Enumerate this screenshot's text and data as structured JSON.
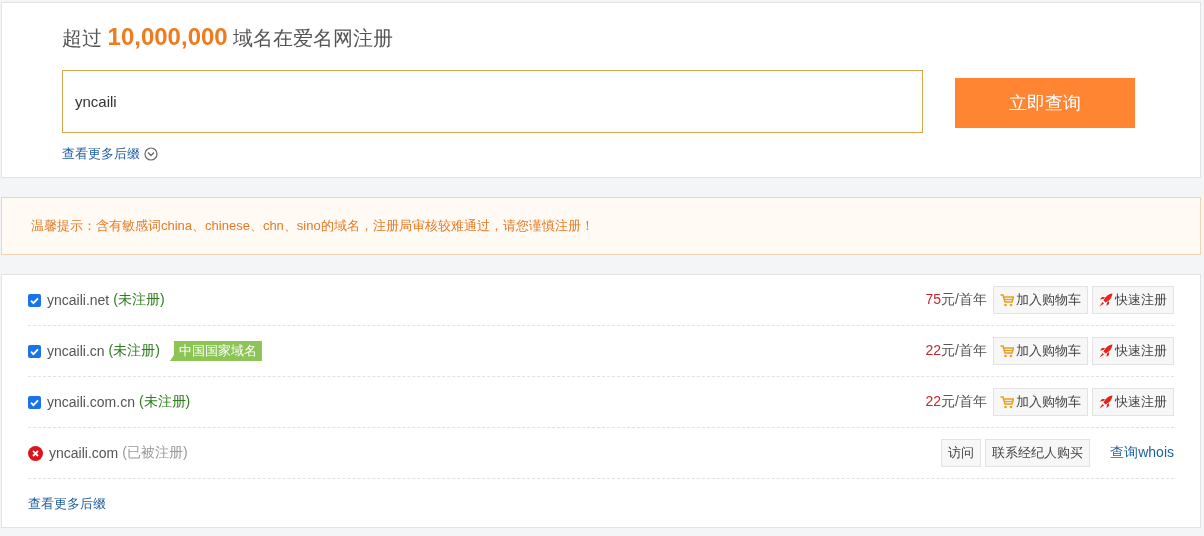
{
  "search": {
    "headline": "超过 **10,000,000** 域名在爱名网注册",
    "value": "yncaili",
    "button": "立即查询",
    "more_link": "查看更多后缀"
  },
  "notice": {
    "text": "温馨提示：含有敏感词china、chinese、chn、sino的域名，注册局审核较难通过，请您谨慎注册！"
  },
  "results": {
    "rows": [
      {
        "kind": "available",
        "checked": true,
        "domain": "yncaili.net",
        "status": "(未注册)",
        "price": "75",
        "unit": "元/首年",
        "actions": [
          {
            "kind": "cart",
            "label": "加入购物车"
          },
          {
            "kind": "quick",
            "label": "快速注册"
          }
        ]
      },
      {
        "kind": "available",
        "checked": true,
        "domain": "yncaili.cn",
        "status": "(未注册)",
        "tag": "中国国家域名",
        "price": "22",
        "unit": "元/首年",
        "actions": [
          {
            "kind": "cart",
            "label": "加入购物车"
          },
          {
            "kind": "quick",
            "label": "快速注册"
          }
        ]
      },
      {
        "kind": "available",
        "checked": true,
        "domain": "yncaili.com.cn",
        "status": "(未注册)",
        "price": "22",
        "unit": "元/首年",
        "actions": [
          {
            "kind": "cart",
            "label": "加入购物车"
          },
          {
            "kind": "quick",
            "label": "快速注册"
          }
        ]
      },
      {
        "kind": "taken",
        "domain": "yncaili.com",
        "status": "(已被注册)",
        "actions": [
          {
            "kind": "plain",
            "label": "访问"
          },
          {
            "kind": "plain",
            "label": "联系经纪人购买"
          },
          {
            "kind": "link",
            "label": "查询whois"
          }
        ]
      }
    ],
    "more_link": "查看更多后缀"
  }
}
